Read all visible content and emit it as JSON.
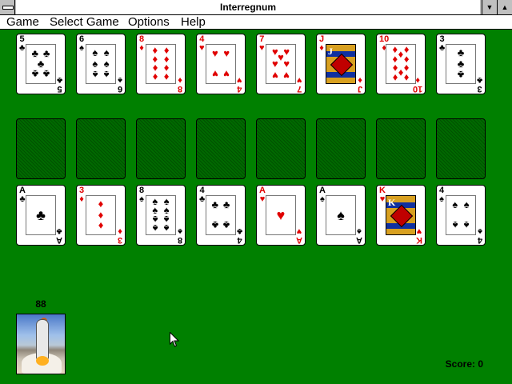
{
  "window": {
    "title": "Interregnum"
  },
  "menu": [
    "Game",
    "Select Game",
    "Options",
    "Help"
  ],
  "colors": {
    "felt": "#008000",
    "red": "#e00000",
    "black": "#000000"
  },
  "foundation_row": [
    {
      "rank": "5",
      "suit": "♣"
    },
    {
      "rank": "6",
      "suit": "♠"
    },
    {
      "rank": "8",
      "suit": "♦"
    },
    {
      "rank": "4",
      "suit": "♥"
    },
    {
      "rank": "7",
      "suit": "♥"
    },
    {
      "rank": "J",
      "suit": "♦"
    },
    {
      "rank": "10",
      "suit": "♦"
    },
    {
      "rank": "3",
      "suit": "♣"
    }
  ],
  "empty_slot_count": 8,
  "tableau_row": [
    {
      "rank": "A",
      "suit": "♣"
    },
    {
      "rank": "3",
      "suit": "♦"
    },
    {
      "rank": "8",
      "suit": "♠"
    },
    {
      "rank": "4",
      "suit": "♣"
    },
    {
      "rank": "A",
      "suit": "♥"
    },
    {
      "rank": "A",
      "suit": "♠"
    },
    {
      "rank": "K",
      "suit": "♥"
    },
    {
      "rank": "4",
      "suit": "♠"
    }
  ],
  "deck": {
    "count": "88",
    "back_icon": "space-shuttle-launch"
  },
  "status": {
    "score_text": "Score: 0"
  },
  "cursor_icon": "arrow-pointer-icon"
}
